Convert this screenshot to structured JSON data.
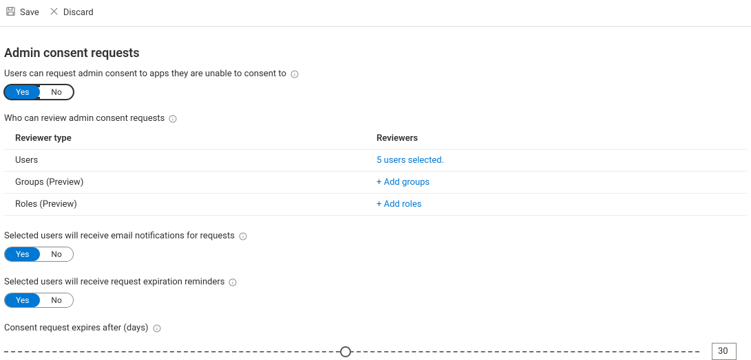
{
  "toolbar": {
    "save_label": "Save",
    "discard_label": "Discard"
  },
  "section_title": "Admin consent requests",
  "toggles": {
    "enable_requests": {
      "label": "Users can request admin consent to apps they are unable to consent to",
      "yes": "Yes",
      "no": "No",
      "value": "Yes",
      "focused": true
    },
    "email_notifications": {
      "label": "Selected users will receive email notifications for requests",
      "yes": "Yes",
      "no": "No",
      "value": "Yes"
    },
    "expiration_reminders": {
      "label": "Selected users will receive request expiration reminders",
      "yes": "Yes",
      "no": "No",
      "value": "Yes"
    }
  },
  "reviewers_header": "Who can review admin consent requests",
  "reviewers_table": {
    "col_type": "Reviewer type",
    "col_reviewers": "Reviewers",
    "rows": [
      {
        "type": "Users",
        "value": "5 users selected."
      },
      {
        "type": "Groups (Preview)",
        "value": "+ Add groups"
      },
      {
        "type": "Roles (Preview)",
        "value": "+ Add roles"
      }
    ]
  },
  "expiry": {
    "label": "Consent request expires after (days)",
    "value": "30",
    "min": 1,
    "max": 60,
    "current": 30
  }
}
